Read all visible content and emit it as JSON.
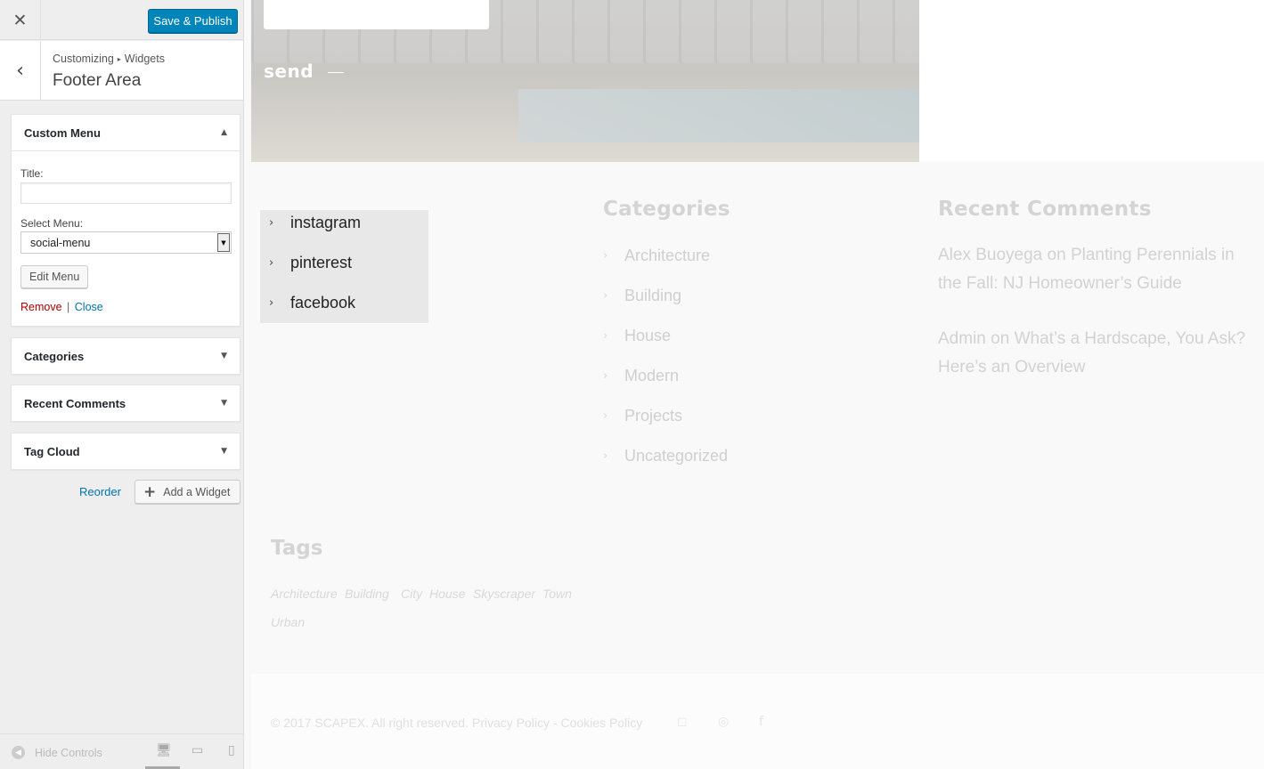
{
  "customizer": {
    "close_icon": "✕",
    "publish_label": "Save & Publish",
    "back_icon": "‹",
    "breadcrumb": {
      "parent": "Customizing",
      "separator": "▸",
      "current": "Widgets"
    },
    "section_title": "Footer Area",
    "widgets": {
      "custom_menu": {
        "title": "Custom Menu",
        "title_label": "Title:",
        "title_value": "",
        "select_label": "Select Menu:",
        "select_value": "social-menu",
        "edit_menu_label": "Edit Menu",
        "remove_label": "Remove",
        "separator": "|",
        "close_label": "Close",
        "expanded": true
      },
      "categories": {
        "title": "Categories"
      },
      "recent_comments": {
        "title": "Recent Comments"
      },
      "tag_cloud": {
        "title": "Tag Cloud"
      }
    },
    "reorder_label": "Reorder",
    "add_widget_label": "Add a Widget",
    "footer": {
      "hide_controls_label": "Hide Controls",
      "devices": [
        "desktop",
        "tablet",
        "mobile"
      ],
      "active_device": "desktop"
    }
  },
  "preview": {
    "hero_send_label": "send",
    "social_menu": [
      "instagram",
      "pinterest",
      "facebook"
    ],
    "categories_heading": "Categories",
    "categories": [
      "Architecture",
      "Building",
      "House",
      "Modern",
      "Projects",
      "Uncategorized"
    ],
    "recent_comments_heading": "Recent Comments",
    "recent_comments": [
      {
        "author": "Alex Buoyega",
        "on": "on",
        "post": "Planting Perennials in the Fall: NJ Homeowner’s Guide"
      },
      {
        "author": "Admin",
        "on": "on",
        "post": "What’s a Hardscape, You Ask? Here’s an Overview"
      }
    ],
    "tags_heading": "Tags",
    "tags": [
      "Architecture",
      "Building",
      "City",
      "House",
      "Skyscraper",
      "Town",
      "Urban"
    ],
    "copyright": "© 2017 SCAPEX. All right reserved.",
    "privacy_link": "Privacy Policy",
    "link_separator": "-",
    "cookies_link": "Cookies Policy"
  },
  "colors": {
    "publish": "#0085ba",
    "link": "#0073aa",
    "remove": "#aa0000"
  }
}
